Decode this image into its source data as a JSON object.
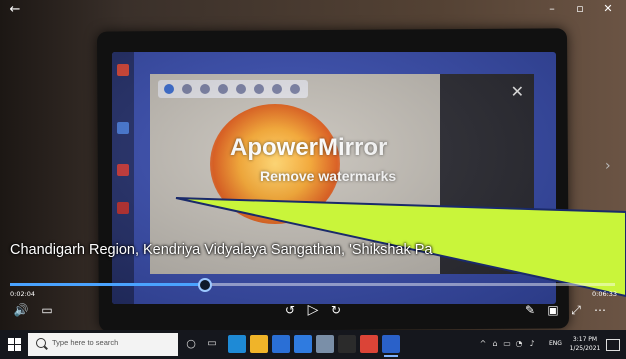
{
  "video": {
    "watermark_title": "ApowerMirror",
    "watermark_subtitle": "Remove watermarks",
    "phone_close": "✕"
  },
  "window": {
    "back_glyph": "←",
    "minimize_glyph": "–",
    "maximize_glyph": "▫",
    "close_glyph": "✕",
    "next_glyph": "›"
  },
  "caption": "Chandigarh Region, Kendriya Vidyalaya Sangathan, 'Shikshak Pa",
  "player": {
    "elapsed": "0:02:04",
    "total": "0:06:33",
    "progress": 0.32,
    "volume_glyph": "🔊",
    "subtitles_glyph": "▭",
    "rewind_glyph": "↺",
    "play_glyph": "▷",
    "forward_glyph": "↻",
    "edit_glyph": "✎",
    "miniview_glyph": "▣",
    "fullscreen_glyph": "⤢",
    "more_glyph": "⋯",
    "accent_color": "#4aa3ff"
  },
  "taskbar": {
    "search_placeholder": "Type here to search",
    "task_view_glyph": "▭",
    "apps": [
      {
        "name": "cortana-icon",
        "color": "#15171d",
        "glyph": "○"
      },
      {
        "name": "edge-icon",
        "color": "#1e8ad6"
      },
      {
        "name": "file-explorer-icon",
        "color": "#f0b429"
      },
      {
        "name": "store-icon",
        "color": "#2a6fd6"
      },
      {
        "name": "mail-icon",
        "color": "#2f7be0"
      },
      {
        "name": "photos-icon",
        "color": "#7a8fa8"
      },
      {
        "name": "camera-icon",
        "color": "#2b2b2b"
      },
      {
        "name": "chrome-icon",
        "color": "#db4437"
      },
      {
        "name": "movies-tv-icon",
        "color": "#2a61c9"
      }
    ],
    "tray_glyphs": [
      "^",
      "⌂",
      "▭",
      "◔",
      "♪"
    ],
    "language": "ENG",
    "time": "3:17 PM",
    "date": "1/25/2021"
  }
}
